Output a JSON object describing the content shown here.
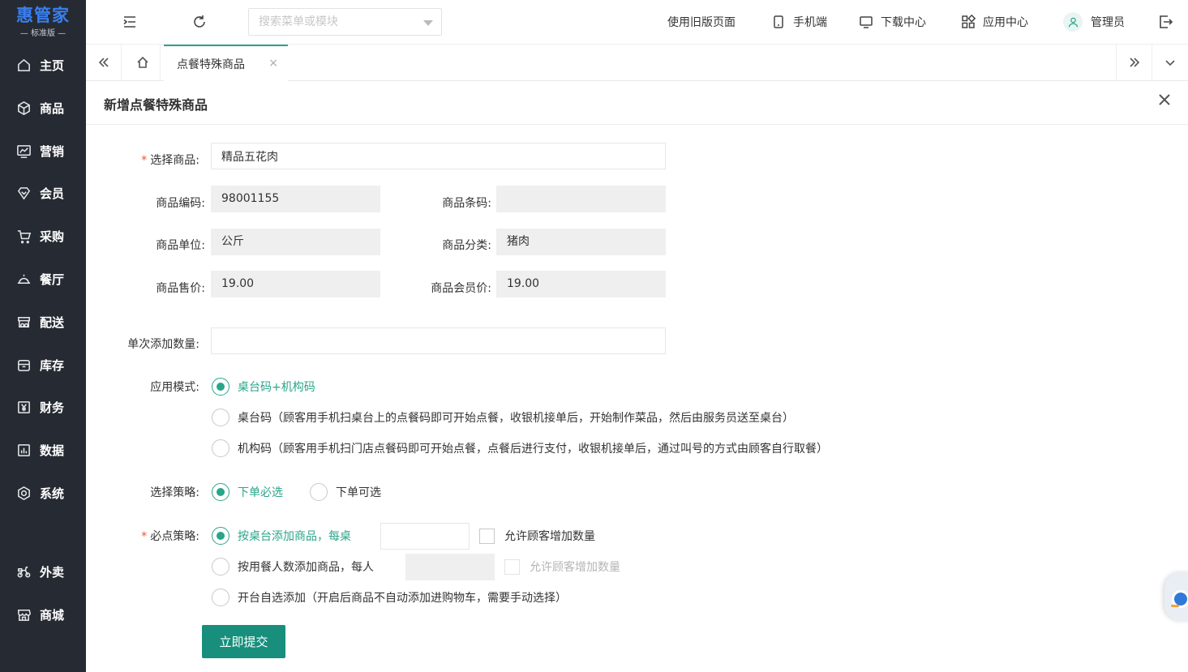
{
  "app": {
    "logo": "惠管家",
    "edition": "标准版"
  },
  "sidebar": {
    "items": [
      {
        "label": "主页",
        "icon": "home-icon"
      },
      {
        "label": "商品",
        "icon": "box-icon"
      },
      {
        "label": "营销",
        "icon": "chart-icon"
      },
      {
        "label": "会员",
        "icon": "diamond-icon"
      },
      {
        "label": "采购",
        "icon": "cart-icon"
      },
      {
        "label": "餐厅",
        "icon": "cloche-icon"
      },
      {
        "label": "配送",
        "icon": "truck-icon"
      },
      {
        "label": "库存",
        "icon": "inventory-icon"
      },
      {
        "label": "财务",
        "icon": "yen-icon"
      },
      {
        "label": "数据",
        "icon": "bar-chart-icon"
      },
      {
        "label": "系统",
        "icon": "settings-icon"
      },
      {
        "label": "外卖",
        "icon": "scooter-icon"
      },
      {
        "label": "商城",
        "icon": "store-icon"
      }
    ]
  },
  "header": {
    "search_placeholder": "搜索菜单或模块",
    "old_version": "使用旧版页面",
    "mobile": "手机端",
    "downloads": "下载中心",
    "apps": "应用中心",
    "user": "管理员"
  },
  "tabs": {
    "active": "点餐特殊商品",
    "close": "×"
  },
  "form": {
    "title": "新增点餐特殊商品",
    "required_mark": "*",
    "product_label": "选择商品:",
    "product_value": "精品五花肉",
    "code_label": "商品编码:",
    "code_value": "98001155",
    "barcode_label": "商品条码:",
    "barcode_value": "",
    "unit_label": "商品单位:",
    "unit_value": "公斤",
    "category_label": "商品分类:",
    "category_value": "猪肉",
    "price_label": "商品售价:",
    "price_value": "19.00",
    "member_price_label": "商品会员价:",
    "member_price_value": "19.00",
    "qty_label": "单次添加数量:",
    "qty_value": "",
    "mode_label": "应用模式:",
    "mode_options": [
      "桌台码+机构码",
      "桌台码（顾客用手机扫桌台上的点餐码即可开始点餐，收银机接单后，开始制作菜品，然后由服务员送至桌台）",
      "机构码（顾客用手机扫门店点餐码即可开始点餐，点餐后进行支付，收银机接单后，通过叫号的方式由顾客自行取餐）"
    ],
    "strategy_label": "选择策略:",
    "strategy_options": [
      "下单必选",
      "下单可选"
    ],
    "must_label": "必点策略:",
    "must_options": [
      "按桌台添加商品，每桌",
      "按用餐人数添加商品，每人",
      "开台自选添加（开启后商品不自动添加进购物车，需要手动选择）"
    ],
    "allow_increase": "允许顾客增加数量",
    "submit": "立即提交"
  }
}
